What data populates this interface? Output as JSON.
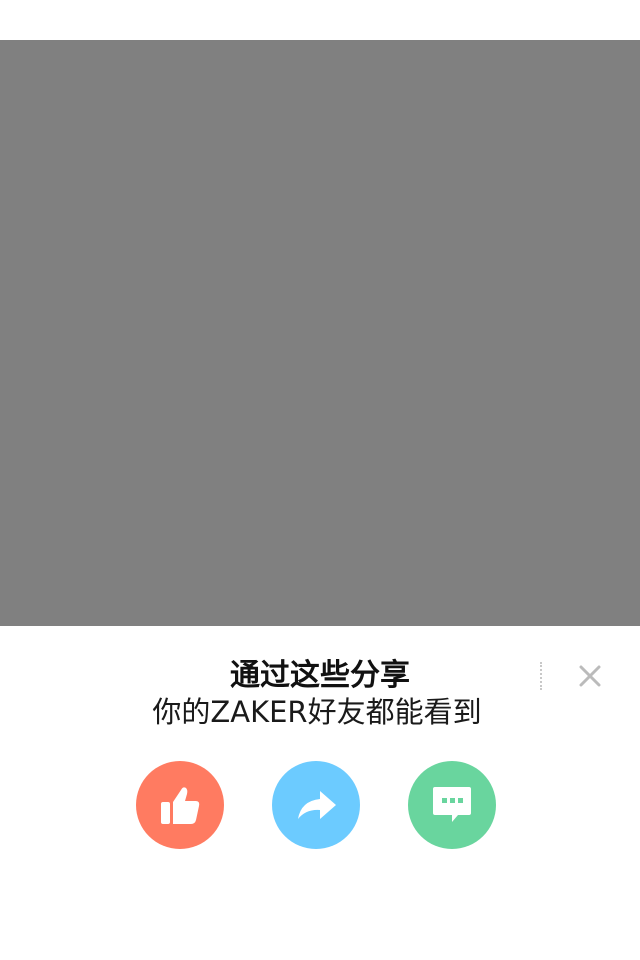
{
  "share_sheet": {
    "title": "通过这些分享",
    "subtitle": "你的ZAKER好友都能看到",
    "close_icon": "close-icon",
    "actions": [
      {
        "name": "like",
        "icon": "thumbs-up-icon",
        "color": "#FF7B61"
      },
      {
        "name": "forward",
        "icon": "share-arrow-icon",
        "color": "#6CCBFF"
      },
      {
        "name": "comment",
        "icon": "chat-bubble-icon",
        "color": "#69D59E"
      }
    ]
  },
  "colors": {
    "overlay": "#808080",
    "background": "#FFFFFF",
    "close_icon": "#BBBBBB"
  }
}
